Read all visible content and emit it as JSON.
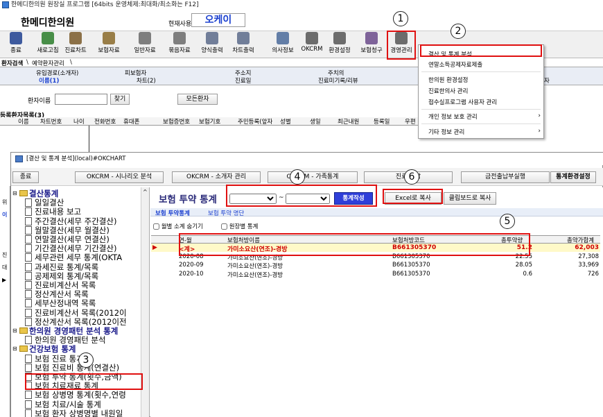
{
  "window": {
    "title": "한메디한의원 원장실 프로그램 [64bits 운영체제:최대화/최소화는 F12]"
  },
  "header": {
    "brand": "한메디한의원",
    "current_user_label": "현재사용자",
    "current_user": "오케이"
  },
  "toolbar": [
    {
      "label": "종료",
      "icon": "exit-icon",
      "color": "#1e3f8f"
    },
    {
      "label": "새로고침",
      "icon": "refresh-icon",
      "color": "#2a7d2a"
    },
    {
      "label": "진료차트",
      "icon": "chart-icon",
      "color": "#7a5a2a"
    },
    {
      "label": "보험자료",
      "icon": "insurance-icon",
      "color": "#8a6a2a"
    },
    {
      "label": "일반자료",
      "icon": "general-data-icon",
      "color": "#6a6a6a"
    },
    {
      "label": "묶음자료",
      "icon": "bundle-icon",
      "color": "#6a6a6a"
    },
    {
      "label": "양식출력",
      "icon": "form-print-icon",
      "color": "#5a6a8a"
    },
    {
      "label": "차트출력",
      "icon": "chart-print-icon",
      "color": "#5a6a8a"
    },
    {
      "label": "의사정보",
      "icon": "doctor-info-icon",
      "color": "#4a6a9a"
    },
    {
      "label": "OKCRM",
      "icon": "crm-icon",
      "color": "#555"
    },
    {
      "label": "환경설정",
      "icon": "settings-icon",
      "color": "#555"
    },
    {
      "label": "보험청구",
      "icon": "claim-icon",
      "color": "#6a4a8a"
    },
    {
      "label": "경영관리",
      "icon": "management-icon",
      "color": "#555"
    }
  ],
  "tabs": [
    "환자검색",
    "예약환자관리"
  ],
  "grid_headers_row1": [
    "유입경로(소개자)",
    "피보험자",
    "주소지",
    "주치의"
  ],
  "grid_headers_row2": [
    "이름(1)",
    "차트(2)",
    "진료일",
    "진료미기록/리뷰",
    "자"
  ],
  "search": {
    "label": "환자이름",
    "find_button": "찾기",
    "all_button": "모든환자"
  },
  "registered": {
    "title": "등록환자목록(3)",
    "columns": [
      "이름",
      "차트번호",
      "나이",
      "전화번호",
      "휴대폰",
      "보험증번호",
      "보험기호",
      "주민등록(앞자",
      "성별",
      "생일",
      "최근내원",
      "등록일",
      "우편"
    ]
  },
  "menu": {
    "items": [
      {
        "label": "결산 및 통계 분석",
        "highlight": true
      },
      {
        "label": "연말소득공제자료제출"
      },
      {
        "label": "한의원 환경설정"
      },
      {
        "label": "진료한의사 관리"
      },
      {
        "label": "접수실프로그램 사용자 관리"
      },
      {
        "label": "개인 정보 보호 관리",
        "submenu": true
      },
      {
        "label": "기타 정보 관리",
        "submenu": true
      }
    ]
  },
  "child": {
    "title": "[결산 및 통계 분석](local)#OKCHART",
    "toolbar": [
      "종료",
      "OKCRM - 시나리오 분석",
      "OKCRM - 소개자 관리",
      "OKCRM - 가족통계",
      "진료/수납",
      "금전출납부실행",
      "통계환경설정"
    ],
    "tree": [
      {
        "label": "결산통계",
        "type": "folder",
        "bold": true,
        "level": 0
      },
      {
        "label": "일일결산",
        "type": "doc",
        "level": 1
      },
      {
        "label": "진료내용 보고",
        "type": "doc",
        "level": 1
      },
      {
        "label": "주간결산(세무 주간결산)",
        "type": "doc",
        "level": 1
      },
      {
        "label": "월말결산(세무 월결산)",
        "type": "doc",
        "level": 1
      },
      {
        "label": "연말결산(세무 연결산)",
        "type": "doc",
        "level": 1
      },
      {
        "label": "기간결산(세무 기간결산)",
        "type": "doc",
        "level": 1
      },
      {
        "label": "세무관련 세무 통계(OKTA",
        "type": "doc",
        "level": 1
      },
      {
        "label": "과세진료 통계/목록",
        "type": "doc",
        "level": 1
      },
      {
        "label": "공제제외 통계/목록",
        "type": "doc",
        "level": 1
      },
      {
        "label": "진료비계산서 목록",
        "type": "doc",
        "level": 1
      },
      {
        "label": "정산계산서 목록",
        "type": "doc",
        "level": 1
      },
      {
        "label": "세부산정내역 목록",
        "type": "doc",
        "level": 1
      },
      {
        "label": "진료비계산서 목록(2012이",
        "type": "doc",
        "level": 1
      },
      {
        "label": "정산계산서 목록(2012이전",
        "type": "doc",
        "level": 1
      },
      {
        "label": "한의원 경영패턴 분석 통계",
        "type": "folder",
        "bold": true,
        "level": 0
      },
      {
        "label": "한의원 경영패턴 분석",
        "type": "doc",
        "level": 1
      },
      {
        "label": "건강보험 통계",
        "type": "folder",
        "bold": true,
        "level": 0
      },
      {
        "label": "보험 진료 통계",
        "type": "doc",
        "level": 1
      },
      {
        "label": "보험 진료비 통계(연결산)",
        "type": "doc",
        "level": 1
      },
      {
        "label": "보험 투약 통계(횟수,금액)",
        "type": "doc",
        "level": 1
      },
      {
        "label": "보험 치료재료 통계",
        "type": "doc",
        "level": 1
      },
      {
        "label": "보험 상병명 통계(횟수,연령",
        "type": "doc",
        "level": 1
      },
      {
        "label": "보험 치료/시술 통계",
        "type": "doc",
        "level": 1
      },
      {
        "label": "보험 환자 상병명별 내원일",
        "type": "doc",
        "level": 1
      }
    ],
    "panel_title": "보험 투약 통계",
    "date_sep": "~",
    "stat_button": "통계작성",
    "excel_button": "Excel로 복사",
    "clipboard_button": "클립보드로 복사",
    "subtabs": [
      "보험 투약통계",
      "보험 투약 명단"
    ],
    "options": [
      "월별 소계 숨기기",
      "원장별 통계"
    ],
    "table_headers": [
      "연-월",
      "보험처방이름",
      "보험처방코드",
      "총투약량",
      "총약가합계"
    ],
    "rows": [
      {
        "month": "<계>",
        "name": "가미소요산(연조)-경방",
        "code": "B661305370",
        "qty": "51.2",
        "total": "62,003",
        "summary": true
      },
      {
        "month": "2020-08",
        "name": "가미소요산(연조)-경방",
        "code": "B661305370",
        "qty": "22.55",
        "total": "27,308"
      },
      {
        "month": "2020-09",
        "name": "가미소요산(연조)-경방",
        "code": "B661305370",
        "qty": "28.05",
        "total": "33,969"
      },
      {
        "month": "2020-10",
        "name": "가미소요산(연조)-경방",
        "code": "B661305370",
        "qty": "0.6",
        "total": "726"
      }
    ]
  },
  "annotations": [
    "1",
    "2",
    "3",
    "4",
    "5",
    "6"
  ]
}
